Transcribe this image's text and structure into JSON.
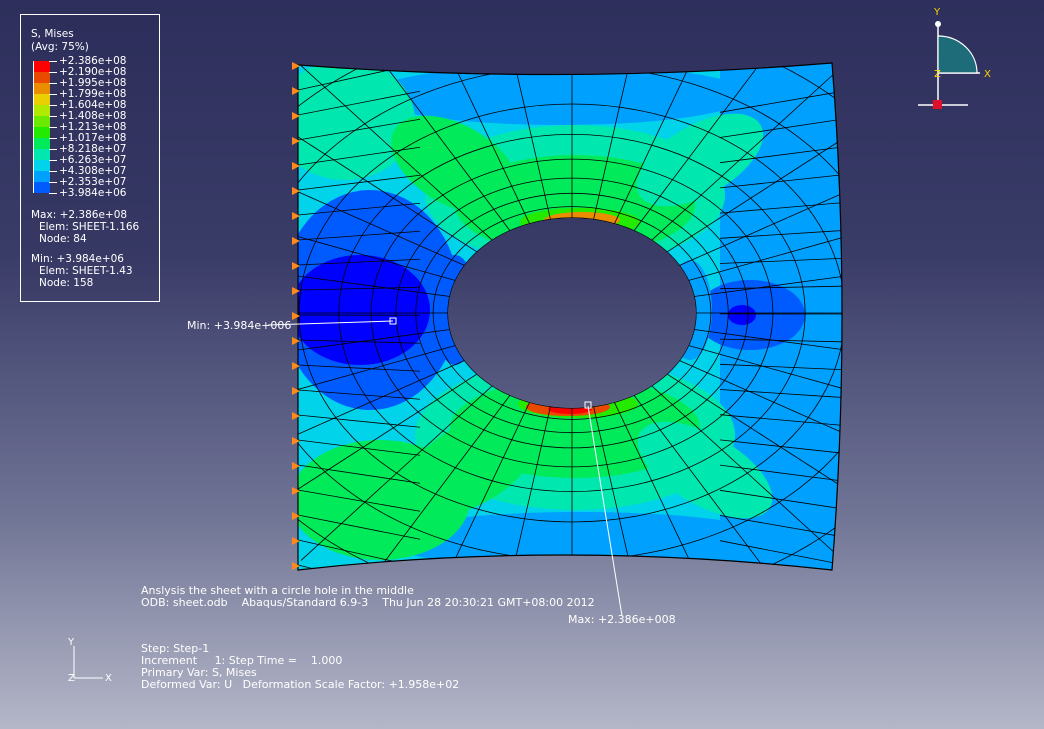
{
  "colors": {
    "contour": [
      "#0000ff",
      "#005bff",
      "#00a0ff",
      "#00d3ea",
      "#00e8b0",
      "#00ea5a",
      "#24ea00",
      "#69ea00",
      "#b0ea00",
      "#ead000",
      "#ea8d00",
      "#ea4a00",
      "#ff0000"
    ],
    "background_top": "#2e2f5c",
    "background_bottom": "#b4b7c8",
    "mesh": "#000000",
    "constraint": "#ff8a1a"
  },
  "legend": {
    "title": "S, Mises",
    "avg": "(Avg: 75%)",
    "values": [
      "+2.386e+08",
      "+2.190e+08",
      "+1.995e+08",
      "+1.799e+08",
      "+1.604e+08",
      "+1.408e+08",
      "+1.213e+08",
      "+1.017e+08",
      "+8.218e+07",
      "+6.263e+07",
      "+4.308e+07",
      "+2.353e+07",
      "+3.984e+06"
    ],
    "max_line": "Max: +2.386e+08",
    "max_elem": "Elem: SHEET-1.166",
    "max_node": "Node: 84",
    "min_line": "Min: +3.984e+06",
    "min_elem": "Elem: SHEET-1.43",
    "min_node": "Node: 158"
  },
  "annotations": {
    "min_label": "Min: +3.984e+006",
    "max_label": "Max: +2.386e+008"
  },
  "info": {
    "title": "Anslysis the sheet with a circle hole in the middle",
    "odb": "ODB: sheet.odb    Abaqus/Standard 6.9-3    Thu Jun 28 20:30:21 GMT+08:00 2012",
    "step": "Step: Step-1",
    "increment": "Increment     1: Step Time =    1.000",
    "primary_var": "Primary Var: S, Mises",
    "deformed_var": "Deformed Var: U   Deformation Scale Factor: +1.958e+02"
  },
  "triad": {
    "view_y": "Y",
    "view_x": "X",
    "view_z": "Z",
    "axis_y": "Y",
    "axis_x": "X",
    "axis_z": "Z"
  }
}
